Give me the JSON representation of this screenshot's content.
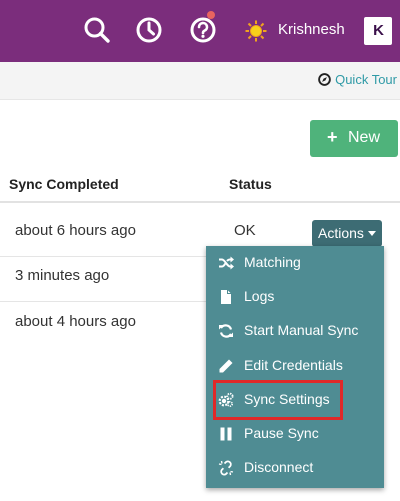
{
  "header": {
    "username": "Krishnesh",
    "brand_logo_text": "K",
    "icons": [
      "search-icon",
      "history-icon",
      "help-icon",
      "user-avatar-icon"
    ],
    "accent_color": "#7b2d7c"
  },
  "subbar": {
    "quick_tour_label": "Quick Tour"
  },
  "toolbar": {
    "new_label": "New"
  },
  "table": {
    "columns": [
      "Sync Completed",
      "Status"
    ],
    "rows": [
      {
        "sync_completed": "about 6 hours ago",
        "status": "OK"
      },
      {
        "sync_completed": "3 minutes ago",
        "status": ""
      },
      {
        "sync_completed": "about 4 hours ago",
        "status": ""
      }
    ]
  },
  "actions": {
    "label": "Actions",
    "menu": [
      {
        "label": "Matching",
        "icon": "shuffle-icon"
      },
      {
        "label": "Logs",
        "icon": "file-icon"
      },
      {
        "label": "Start Manual Sync",
        "icon": "refresh-icon"
      },
      {
        "label": "Edit Credentials",
        "icon": "pencil-icon"
      },
      {
        "label": "Sync Settings",
        "icon": "cogs-icon",
        "highlighted": true
      },
      {
        "label": "Pause Sync",
        "icon": "pause-icon"
      },
      {
        "label": "Disconnect",
        "icon": "unlink-icon"
      }
    ]
  }
}
